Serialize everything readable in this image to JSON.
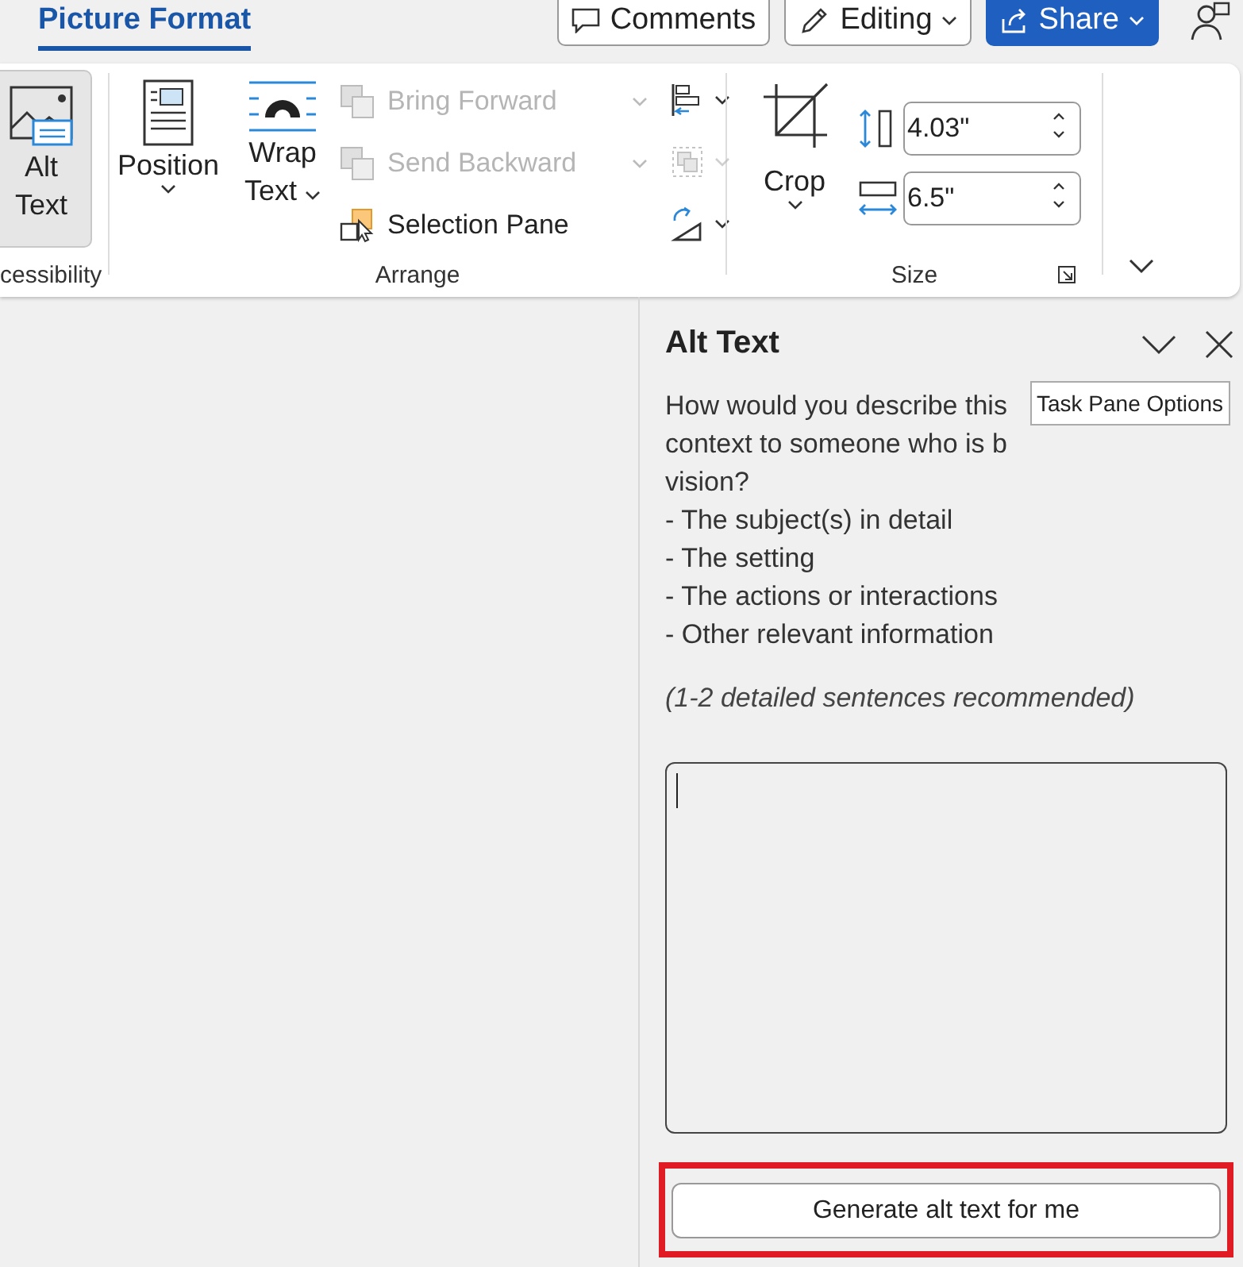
{
  "tabs": [
    {
      "label": "Picture Format",
      "selected": true
    }
  ],
  "header_buttons": [
    {
      "kind": "comments",
      "label": "Comments"
    },
    {
      "kind": "editing",
      "label": "Editing"
    },
    {
      "kind": "share",
      "label": "Share"
    }
  ],
  "ribbon": {
    "accessibility": {
      "button": {
        "label_lines": [
          "Alt",
          "Text"
        ],
        "selected": true
      },
      "group_label": "cessibility"
    },
    "arrange": {
      "position": "Position",
      "wrap_lines": [
        "Wrap",
        "Text"
      ],
      "commands": [
        {
          "kind": "forward",
          "label": "Bring Forward",
          "disabled": true
        },
        {
          "kind": "backward",
          "label": "Send Backward",
          "disabled": true
        },
        {
          "kind": "selection",
          "label": "Selection Pane",
          "disabled": false
        }
      ],
      "small": [
        {
          "kind": "align",
          "disabled": false
        },
        {
          "kind": "group",
          "disabled": true
        },
        {
          "kind": "rotate",
          "disabled": false
        }
      ],
      "group_label": "Arrange"
    },
    "size": {
      "crop": "Crop",
      "height": "4.03\"",
      "width": "6.5\"",
      "group_label": "Size"
    }
  },
  "pane": {
    "title": "Alt Text",
    "description_lines": [
      "How would you describe this",
      "context to someone who is b",
      "vision?",
      "- The subject(s) in detail",
      "- The setting",
      "- The actions or interactions",
      "- Other relevant information"
    ],
    "hint": "(1-2 detailed sentences recommended)",
    "tooltip": "Task Pane Options",
    "generate_button": "Generate alt text for me",
    "highlighted": true
  }
}
